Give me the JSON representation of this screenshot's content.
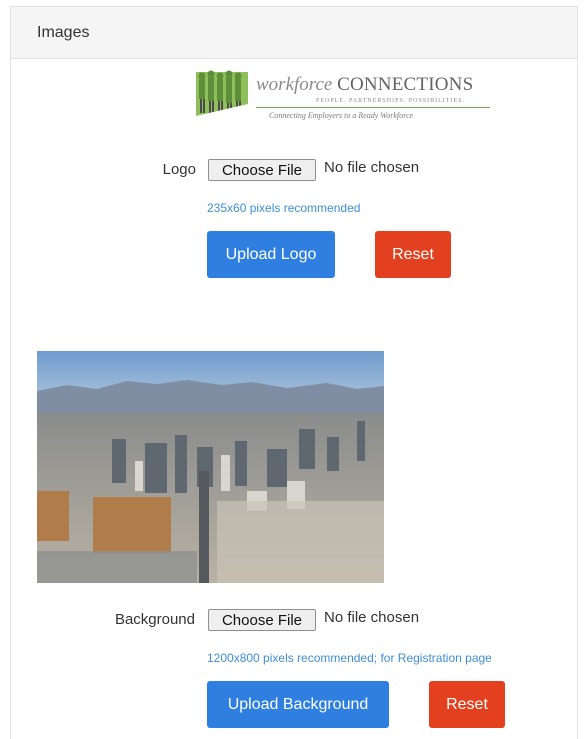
{
  "panel": {
    "title": "Images"
  },
  "logo_preview": {
    "brand_prefix": "workforce",
    "brand_name": "CONNECTIONS",
    "brand_subline": "PEOPLE. PARTNERSHIPS. POSSIBILITIES.",
    "tagline": "Connecting Employers to a Ready Workforce"
  },
  "logo": {
    "label": "Logo",
    "choose_file": "Choose File",
    "file_status": "No file chosen",
    "hint": "235x60 pixels recommended",
    "upload_button": "Upload Logo",
    "reset_button": "Reset"
  },
  "background": {
    "label": "Background",
    "choose_file": "Choose File",
    "file_status": "No file chosen",
    "hint": "1200x800 pixels recommended; for Registration page",
    "upload_button": "Upload Background",
    "reset_button": "Reset"
  },
  "colors": {
    "primary": "#2f7fe0",
    "danger": "#e2401f",
    "hint": "#3f8ed8",
    "logo_green": "#7aa35a"
  }
}
